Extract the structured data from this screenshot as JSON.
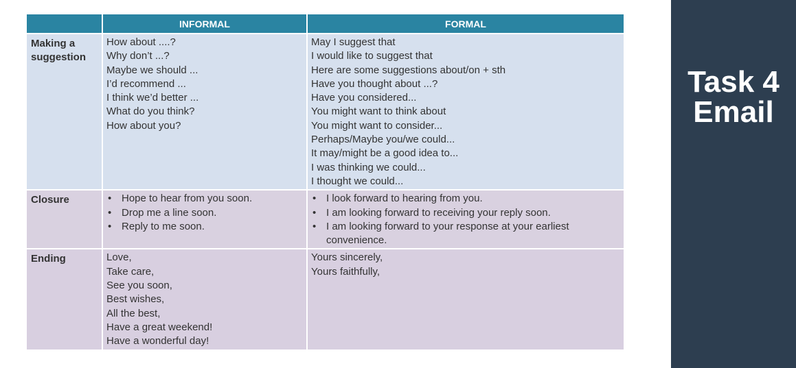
{
  "table": {
    "headers": {
      "informal": "INFORMAL",
      "formal": "FORMAL"
    },
    "rows": {
      "suggestion": {
        "category": "Making a suggestion",
        "informal": [
          "How about ....?",
          "Why don’t ...?",
          "Maybe we should ...",
          "I’d recommend ...",
          "I think we’d better ...",
          "What do you think?",
          "How about you?"
        ],
        "formal": [
          "May I suggest that",
          "I would like to suggest that",
          "Here are some suggestions about/on + sth",
          "Have you thought about ...?",
          "Have you considered...",
          "You might want to think about",
          "You might want to consider...",
          "Perhaps/Maybe you/we could...",
          "It may/might be a good idea to...",
          "I was thinking we could...",
          "I thought we could..."
        ]
      },
      "closure": {
        "category": "Closure",
        "informal": [
          "Hope to hear from you soon.",
          "Drop me a line soon.",
          "Reply to me soon."
        ],
        "formal": [
          "I look forward to hearing from you.",
          "I am looking forward to receiving your reply soon.",
          "I am looking forward to your response at your earliest convenience."
        ]
      },
      "ending": {
        "category": "Ending",
        "informal": [
          "Love,",
          "Take care,",
          "See you soon,",
          "Best wishes,",
          "All the best,",
          "Have a great weekend!",
          "Have a wonderful day!"
        ],
        "formal": [
          "Yours sincerely,",
          "Yours faithfully,"
        ]
      }
    }
  },
  "side_panel": {
    "title_line1": "Task 4",
    "title_line2": "Email"
  },
  "colors": {
    "header_bg": "#2a84a2",
    "suggestion_bg": "#d6e0ee",
    "closure_bg": "#d9d1e0",
    "ending_bg": "#d8cfe0",
    "side_panel_bg": "#2d3e50"
  }
}
